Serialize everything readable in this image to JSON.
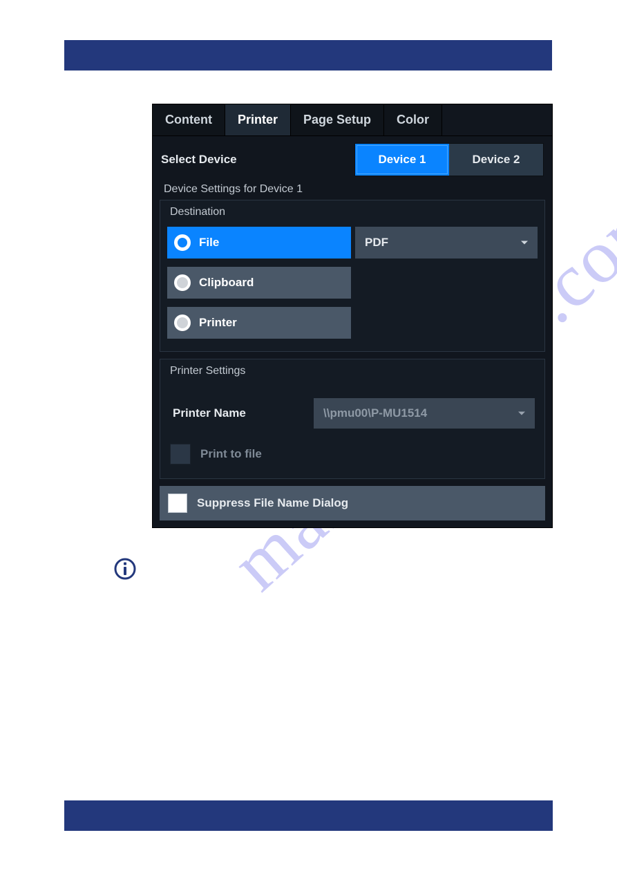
{
  "header": {
    "left": "",
    "right": ""
  },
  "watermark": "manualshive.com",
  "intro": "",
  "panel": {
    "tabs": [
      "Content",
      "Printer",
      "Page Setup",
      "Color"
    ],
    "active_tab_index": 1,
    "select_device_label": "Select Device",
    "devices": [
      "Device 1",
      "Device 2"
    ],
    "active_device_index": 0,
    "device_settings_title": "Device Settings for Device 1",
    "destination": {
      "title": "Destination",
      "options": [
        "File",
        "Clipboard",
        "Printer"
      ],
      "selected_index": 0,
      "file_format": "PDF"
    },
    "printer_settings": {
      "title": "Printer Settings",
      "printer_name_label": "Printer Name",
      "printer_name_value": "\\\\pmu00\\P-MU1514",
      "print_to_file_label": "Print to file",
      "print_to_file_checked": false
    },
    "suppress_label": "Suppress File Name Dialog",
    "suppress_checked": false
  },
  "info_note": "",
  "footer": {
    "manual": "",
    "page": ""
  }
}
